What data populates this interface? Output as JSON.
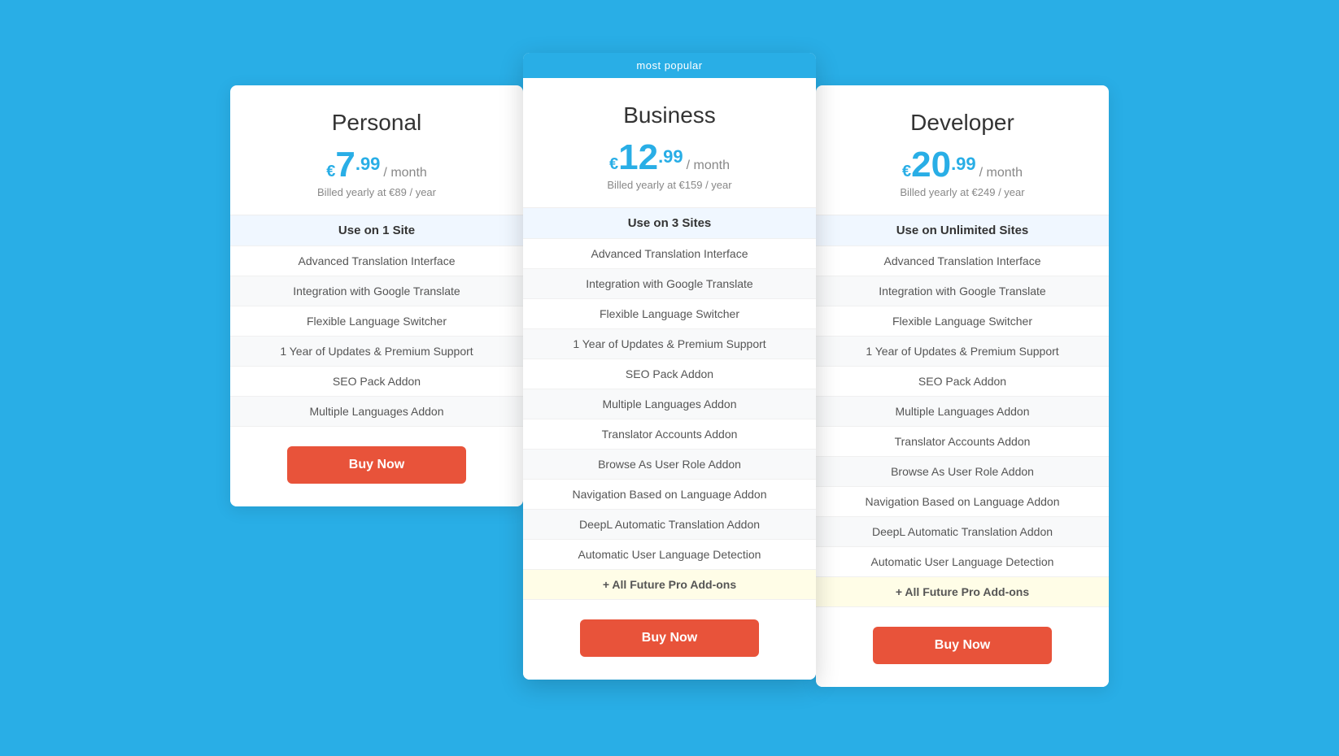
{
  "plans": [
    {
      "id": "personal",
      "name": "Personal",
      "currency_symbol": "€",
      "price_whole": "7",
      "price_decimal": ".99",
      "period": "/ month",
      "billed": "Billed yearly at €89 / year",
      "featured": false,
      "most_popular": false,
      "features": [
        {
          "label": "Use on 1 Site",
          "type": "first"
        },
        {
          "label": "Advanced Translation Interface",
          "type": "normal"
        },
        {
          "label": "Integration with Google Translate",
          "type": "normal"
        },
        {
          "label": "Flexible Language Switcher",
          "type": "normal"
        },
        {
          "label": "1 Year of Updates & Premium Support",
          "type": "normal"
        },
        {
          "label": "SEO Pack Addon",
          "type": "normal"
        },
        {
          "label": "Multiple Languages Addon",
          "type": "normal"
        }
      ],
      "button_label": "Buy Now"
    },
    {
      "id": "business",
      "name": "Business",
      "currency_symbol": "€",
      "price_whole": "12",
      "price_decimal": ".99",
      "period": "/ month",
      "billed": "Billed yearly at €159 / year",
      "featured": true,
      "most_popular": true,
      "most_popular_label": "most popular",
      "features": [
        {
          "label": "Use on 3 Sites",
          "type": "first"
        },
        {
          "label": "Advanced Translation Interface",
          "type": "normal"
        },
        {
          "label": "Integration with Google Translate",
          "type": "normal"
        },
        {
          "label": "Flexible Language Switcher",
          "type": "normal"
        },
        {
          "label": "1 Year of Updates & Premium Support",
          "type": "normal"
        },
        {
          "label": "SEO Pack Addon",
          "type": "normal"
        },
        {
          "label": "Multiple Languages Addon",
          "type": "normal"
        },
        {
          "label": "Translator Accounts Addon",
          "type": "normal"
        },
        {
          "label": "Browse As User Role Addon",
          "type": "normal"
        },
        {
          "label": "Navigation Based on Language Addon",
          "type": "normal"
        },
        {
          "label": "DeepL Automatic Translation Addon",
          "type": "normal"
        },
        {
          "label": "Automatic User Language Detection",
          "type": "normal"
        },
        {
          "label": "+ All Future Pro Add-ons",
          "type": "yellow"
        }
      ],
      "button_label": "Buy Now"
    },
    {
      "id": "developer",
      "name": "Developer",
      "currency_symbol": "€",
      "price_whole": "20",
      "price_decimal": ".99",
      "period": "/ month",
      "billed": "Billed yearly at €249 / year",
      "featured": false,
      "most_popular": false,
      "features": [
        {
          "label": "Use on Unlimited Sites",
          "type": "first"
        },
        {
          "label": "Advanced Translation Interface",
          "type": "normal"
        },
        {
          "label": "Integration with Google Translate",
          "type": "normal"
        },
        {
          "label": "Flexible Language Switcher",
          "type": "normal"
        },
        {
          "label": "1 Year of Updates & Premium Support",
          "type": "normal"
        },
        {
          "label": "SEO Pack Addon",
          "type": "normal"
        },
        {
          "label": "Multiple Languages Addon",
          "type": "normal"
        },
        {
          "label": "Translator Accounts Addon",
          "type": "normal"
        },
        {
          "label": "Browse As User Role Addon",
          "type": "normal"
        },
        {
          "label": "Navigation Based on Language Addon",
          "type": "normal"
        },
        {
          "label": "DeepL Automatic Translation Addon",
          "type": "normal"
        },
        {
          "label": "Automatic User Language Detection",
          "type": "normal"
        },
        {
          "label": "+ All Future Pro Add-ons",
          "type": "yellow"
        }
      ],
      "button_label": "Buy Now"
    }
  ]
}
